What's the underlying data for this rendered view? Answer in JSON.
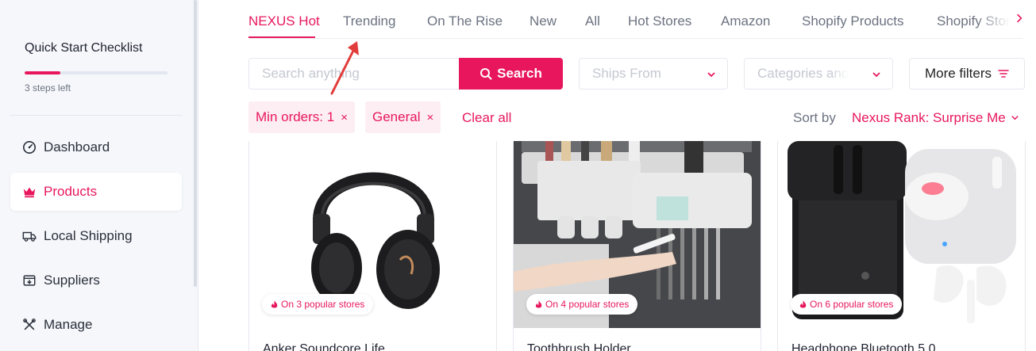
{
  "sidebar": {
    "checklist_title": "Quick Start Checklist",
    "checklist_progress": 0.25,
    "steps_left": "3 steps left",
    "items": [
      {
        "label": "Dashboard",
        "icon": "gauge-icon"
      },
      {
        "label": "Products",
        "icon": "crown-icon",
        "active": true
      },
      {
        "label": "Local Shipping",
        "icon": "truck-icon"
      },
      {
        "label": "Suppliers",
        "icon": "inbox-icon"
      },
      {
        "label": "Manage",
        "icon": "tools-icon"
      }
    ]
  },
  "tabs": [
    {
      "label": "NEXUS Hot",
      "active": true
    },
    {
      "label": "Trending"
    },
    {
      "label": "On The Rise"
    },
    {
      "label": "New"
    },
    {
      "label": "All"
    },
    {
      "label": "Hot Stores"
    },
    {
      "label": "Amazon"
    },
    {
      "label": "Shopify Products"
    },
    {
      "label": "Shopify Stores"
    }
  ],
  "filters": {
    "search_placeholder": "Search anything",
    "search_button": "Search",
    "ships_from_placeholder": "Ships From",
    "categories_placeholder": "Categories and Niches",
    "more_filters": "More filters"
  },
  "chips": {
    "min_orders": "Min orders: 1",
    "general": "General",
    "remove_symbol": "×",
    "clear_all": "Clear all"
  },
  "sort": {
    "label": "Sort by",
    "value": "Nexus Rank: Surprise Me"
  },
  "products": [
    {
      "name": "Anker Soundcore Life",
      "badge": "On 3 popular stores"
    },
    {
      "name": "Toothbrush Holder",
      "badge": "On 4 popular stores"
    },
    {
      "name": "Headphone Bluetooth 5.0",
      "badge": "On 6 popular stores"
    }
  ],
  "colors": {
    "accent": "#e8175d",
    "sidebar_bg": "#f5f7fb"
  }
}
